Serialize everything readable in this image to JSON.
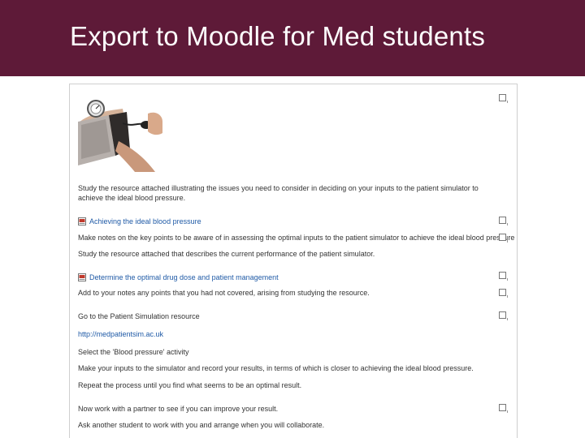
{
  "header": {
    "title": "Export to Moodle for Med students"
  },
  "icons": {
    "photo": "blood-pressure-cuff-photo",
    "resource": "pdf-icon",
    "checkbox": "completion-checkbox"
  },
  "colors": {
    "banner": "#5e1a38",
    "link": "#1f5aa6"
  },
  "activities": [
    {
      "text": "Study the resource attached illustrating the issues you need to consider in deciding on your inputs to the patient simulator to achieve the ideal blood pressure."
    },
    {
      "text": "Achieving the ideal blood pressure"
    },
    {
      "text": "Make notes on the key points to be aware of in assessing the optimal inputs to the patient simulator to achieve the ideal blood pressure"
    },
    {
      "text": "Study the resource attached that describes the current performance of the patient simulator."
    },
    {
      "text": "Determine the optimal drug dose and patient management"
    },
    {
      "text": "Add to your notes any points that you had not covered, arising from studying the resource."
    },
    {
      "text": "Go to the Patient Simulation resource"
    },
    {
      "text": "http://medpatientsim.ac.uk"
    },
    {
      "text": "Select the 'Blood pressure' activity"
    },
    {
      "text": "Make your inputs to the simulator and record your results, in terms of which is closer to achieving the ideal blood pressure."
    },
    {
      "text": "Repeat the process until you find what seems to be an optimal result."
    },
    {
      "text": "Now work with a partner to see if you can improve your result."
    },
    {
      "text": "Ask another student to work with you and arrange when you will collaborate."
    }
  ]
}
